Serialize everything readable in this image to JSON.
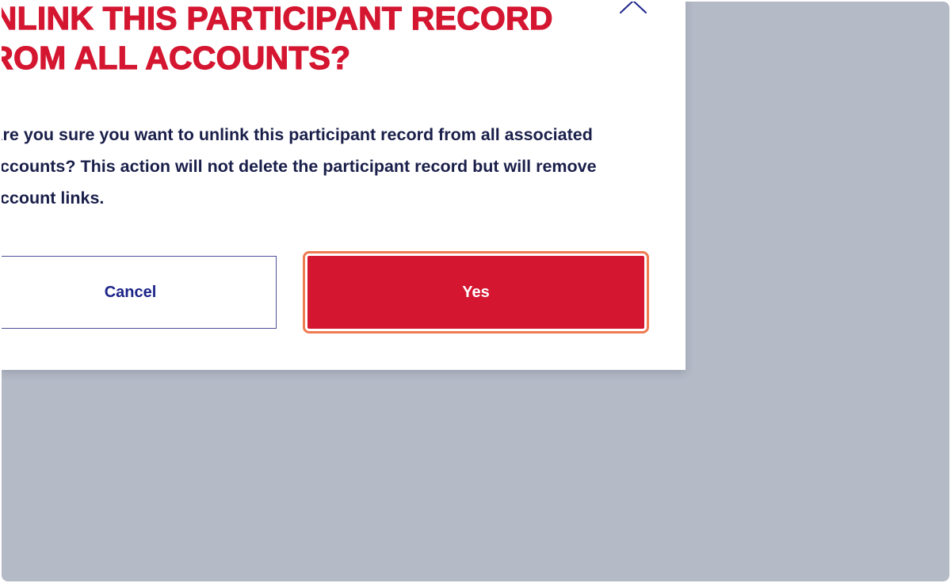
{
  "dialog": {
    "title_lines": [
      "UNLINK THIS PARTICIPANT RECORD",
      "FROM ALL ACCOUNTS?"
    ],
    "message_lines": [
      "Are you sure you want to unlink this participant record from all associated",
      "accounts? This action will not delete the participant record but will remove",
      "account links."
    ],
    "close_icon": "chevron-up-icon",
    "cancel_label": "Cancel",
    "confirm_label": "Yes"
  },
  "colors": {
    "title": "#d41631",
    "message": "#1a1f4a",
    "cancel_text": "#1c2489",
    "cancel_border": "#4b4f96",
    "confirm_bg": "#d41631",
    "confirm_text": "#ffffff",
    "focus_ring": "#ee7b52",
    "overlay": "#b4bac6"
  }
}
